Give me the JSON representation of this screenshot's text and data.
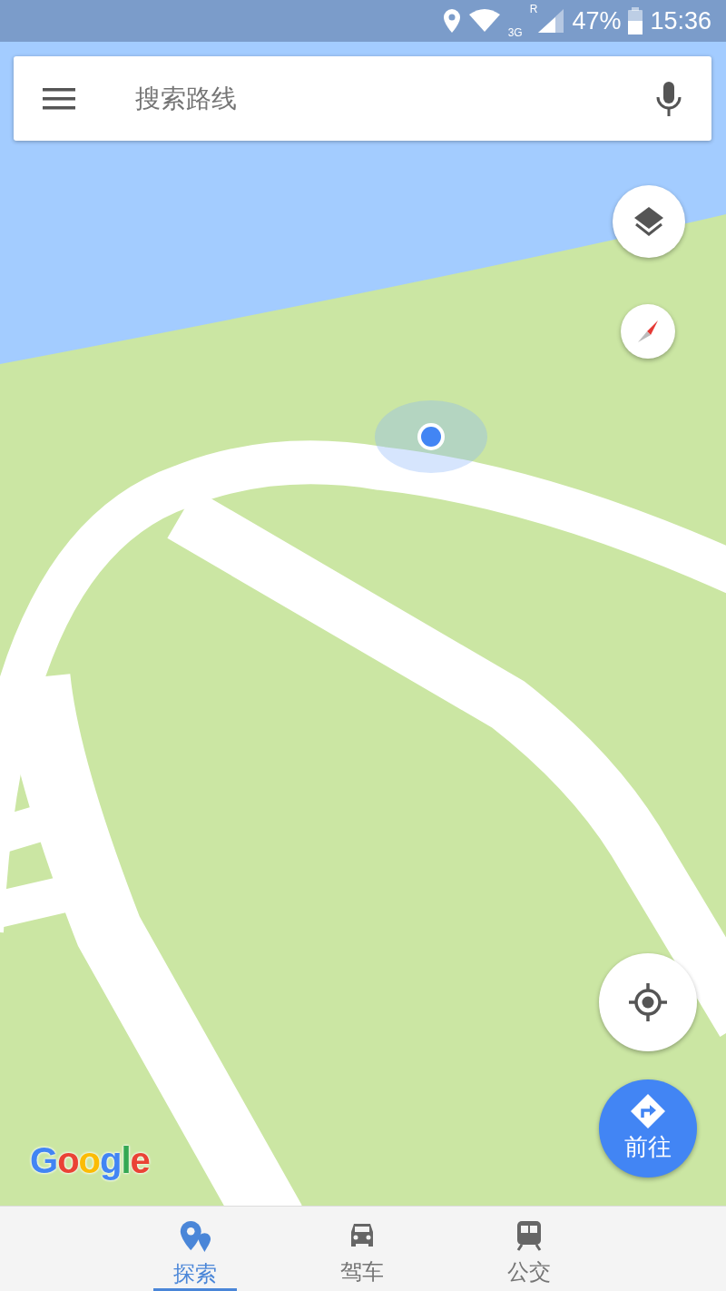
{
  "status_bar": {
    "network": "3G",
    "roaming": "R",
    "battery": "47%",
    "time": "15:36"
  },
  "search": {
    "placeholder": "搜索路线"
  },
  "logo": "Google",
  "go_button": {
    "label": "前往"
  },
  "bottom_nav": [
    {
      "kind": "explore",
      "label": "探索",
      "selected": true
    },
    {
      "kind": "drive",
      "label": "驾车",
      "selected": false
    },
    {
      "kind": "transit",
      "label": "公交",
      "selected": false
    }
  ]
}
